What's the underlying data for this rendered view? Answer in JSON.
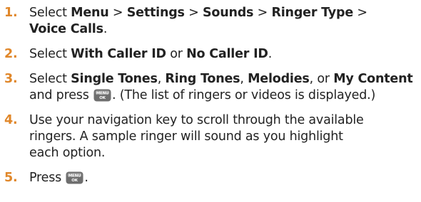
{
  "steps": [
    {
      "number": "1.",
      "segments": [
        {
          "text": "Select ",
          "bold": false
        },
        {
          "text": "Menu",
          "bold": true
        },
        {
          "text": " > ",
          "bold": false
        },
        {
          "text": "Settings",
          "bold": true
        },
        {
          "text": " > ",
          "bold": false
        },
        {
          "text": "Sounds",
          "bold": true
        },
        {
          "text": " > ",
          "bold": false
        },
        {
          "text": "Ringer Type",
          "bold": true
        },
        {
          "text": " >",
          "bold": false
        },
        {
          "break": true
        },
        {
          "text": "Voice Calls",
          "bold": true
        },
        {
          "text": ".",
          "bold": false
        }
      ]
    },
    {
      "number": "2.",
      "segments": [
        {
          "text": "Select ",
          "bold": false
        },
        {
          "text": "With Caller ID",
          "bold": true
        },
        {
          "text": " or ",
          "bold": false
        },
        {
          "text": "No Caller ID",
          "bold": true
        },
        {
          "text": ".",
          "bold": false
        }
      ]
    },
    {
      "number": "3.",
      "segments": [
        {
          "text": "Select ",
          "bold": false
        },
        {
          "text": "Single Tones",
          "bold": true
        },
        {
          "text": ", ",
          "bold": false
        },
        {
          "text": "Ring Tones",
          "bold": true
        },
        {
          "text": ", ",
          "bold": false
        },
        {
          "text": "Melodies",
          "bold": true
        },
        {
          "text": ", or ",
          "bold": false
        },
        {
          "text": "My Content",
          "bold": true
        },
        {
          "break": true
        },
        {
          "text": "and press ",
          "bold": false
        },
        {
          "key": "menu-ok-key-icon",
          "line1": "MENU",
          "line2": "OK"
        },
        {
          "text": ". (The list of ringers or videos is displayed.)",
          "bold": false
        }
      ]
    },
    {
      "number": "4.",
      "segments": [
        {
          "text": "Use your navigation key to scroll through the available",
          "bold": false
        },
        {
          "break": true
        },
        {
          "text": "ringers. A sample ringer will sound as you highlight",
          "bold": false
        },
        {
          "break": true
        },
        {
          "text": "each option.",
          "bold": false
        }
      ]
    },
    {
      "number": "5.",
      "segments": [
        {
          "text": "Press ",
          "bold": false
        },
        {
          "key": "menu-ok-key-icon",
          "line1": "MENU",
          "line2": "OK"
        },
        {
          "text": ".",
          "bold": false
        }
      ]
    }
  ],
  "colors": {
    "step_number": "#e0872a",
    "body_text": "#222222",
    "key_fill": "#6e6e6e",
    "key_text": "#ffffff"
  }
}
